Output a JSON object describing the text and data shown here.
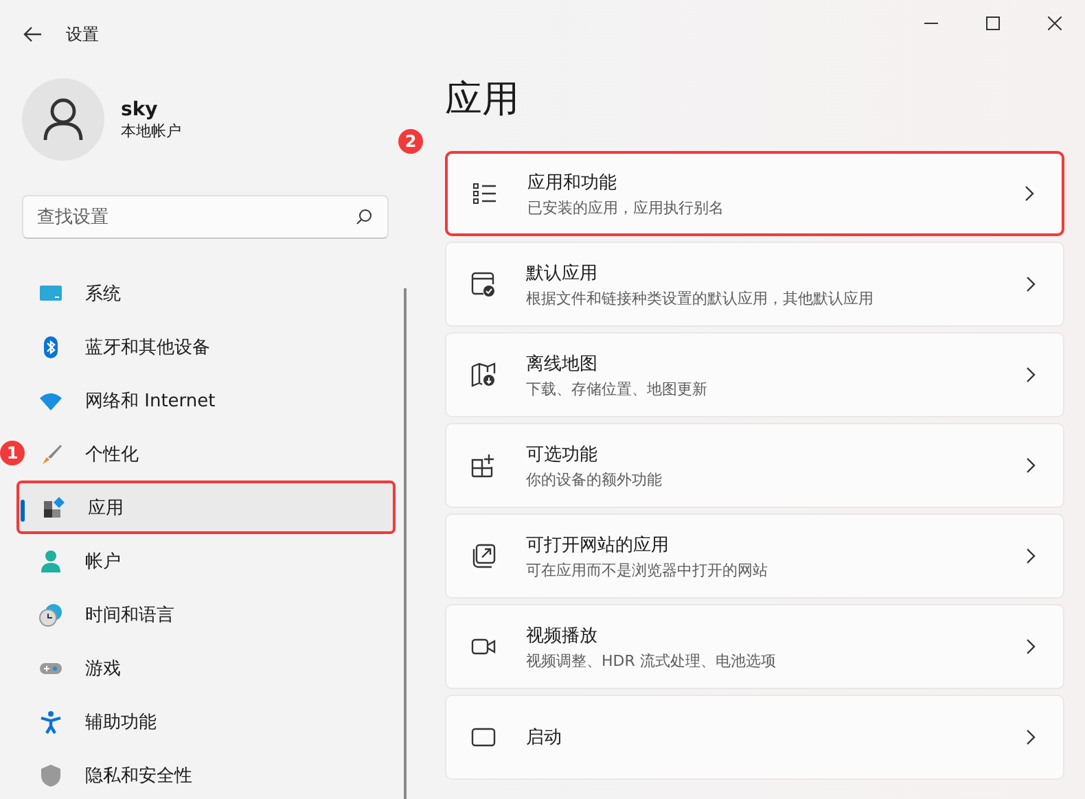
{
  "window": {
    "title": "设置"
  },
  "profile": {
    "name": "sky",
    "account_type": "本地帐户"
  },
  "search": {
    "placeholder": "查找设置"
  },
  "sidebar": {
    "items": [
      {
        "label": "系统",
        "selected": false,
        "highlighted": false
      },
      {
        "label": "蓝牙和其他设备",
        "selected": false,
        "highlighted": false
      },
      {
        "label": "网络和 Internet",
        "selected": false,
        "highlighted": false
      },
      {
        "label": "个性化",
        "selected": false,
        "highlighted": false,
        "annotation": "1"
      },
      {
        "label": "应用",
        "selected": true,
        "highlighted": true
      },
      {
        "label": "帐户",
        "selected": false,
        "highlighted": false
      },
      {
        "label": "时间和语言",
        "selected": false,
        "highlighted": false
      },
      {
        "label": "游戏",
        "selected": false,
        "highlighted": false
      },
      {
        "label": "辅助功能",
        "selected": false,
        "highlighted": false
      },
      {
        "label": "隐私和安全性",
        "selected": false,
        "highlighted": false
      }
    ]
  },
  "page": {
    "heading": "应用",
    "annotation": "2",
    "cards": [
      {
        "title": "应用和功能",
        "subtitle": "已安装的应用，应用执行别名",
        "highlighted": true
      },
      {
        "title": "默认应用",
        "subtitle": "根据文件和链接种类设置的默认应用，其他默认应用",
        "highlighted": false
      },
      {
        "title": "离线地图",
        "subtitle": "下载、存储位置、地图更新",
        "highlighted": false
      },
      {
        "title": "可选功能",
        "subtitle": "你的设备的额外功能",
        "highlighted": false
      },
      {
        "title": "可打开网站的应用",
        "subtitle": "可在应用而不是浏览器中打开的网站",
        "highlighted": false
      },
      {
        "title": "视频播放",
        "subtitle": "视频调整、HDR 流式处理、电池选项",
        "highlighted": false
      },
      {
        "title": "启动",
        "highlighted": false
      }
    ]
  }
}
